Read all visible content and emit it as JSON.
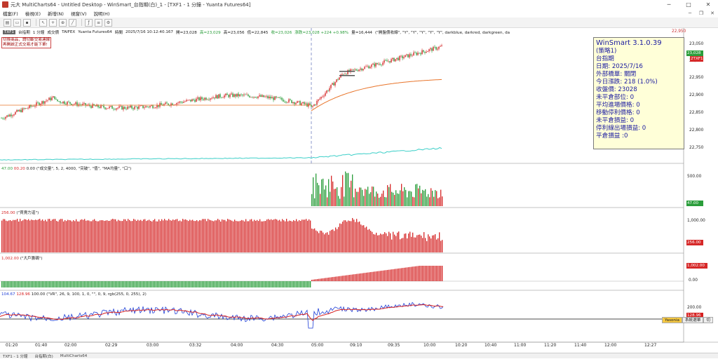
{
  "window": {
    "title": "元大 MultiCharts64 - Untitled Desktop - WinSmart_台指期(白)_1 - [TXF1 - 1 分鐘 - Yuanta Futures64]"
  },
  "menu": [
    "檔案(F)",
    "檢視(E)",
    "新增(N)",
    "視窗(V)",
    "說明(H)"
  ],
  "statusline": {
    "symbol": "TXF1",
    "description": "台指期",
    "interval": "1 分鐘",
    "settings": "成交價",
    "exchange": "TAIFEX",
    "feed": "Yuanta Futures64",
    "date_label": "時間",
    "datetime": "2025/7/16 10:12:40.167",
    "open": "開=23,028",
    "high": "高=23,029",
    "low": "低=22,849",
    "close": "高=23,056",
    "volume_low": "低=22,845",
    "close2": "收=23,026",
    "change": "漲跌=23,028 +224 +0.98%",
    "qty": "量=16,444",
    "study": "(\"開盤價收線\", \"Y\", \"Y\", \"Y\", \"Y\", \"Y\", darkblue, darkred, darkgreen, da"
  },
  "notice": {
    "line1": "切換商品，請切斷交易連線",
    "line2": "再開啟正式交易才能下單!"
  },
  "infobox": {
    "title": "WinSmart 3.1.0.39",
    "strategy": "(策略1)",
    "product": "台指期",
    "date": "日期: 2025/7/16",
    "order": "外部橋單: 關閉",
    "change": "今日漲跌: 218 (1.0%)",
    "close": "收盤價: 23028",
    "position": "未平倉部位: 0",
    "avg_price": "平均進場價格: 0",
    "trail_stop": "移動停利價格: 0",
    "unrealized": "未平倉損益: 0",
    "exit_pl": "停利線出場損益: 0",
    "closed_pl": "平倉損益 :0"
  },
  "panes": {
    "price": {
      "axis": [
        "23,050",
        "23,000",
        "22,950",
        "22,900",
        "22,850",
        "22,800",
        "22,750"
      ],
      "top_label": "22,950",
      "tag": "23,028",
      "tag2": "2TXF1"
    },
    "volume": {
      "legend_vals": [
        "47.00",
        "00.20",
        "0.00"
      ],
      "legend": "(\"成交量\", 5, 2, 4000, \"突破\", \"值\", \"MA均量\", \"口\")",
      "axis": [
        "500.00"
      ],
      "tag": "47.00"
    },
    "buy_sell": {
      "legend_val": "256.00",
      "legend": "(\"買賣力道\")",
      "axis": [
        "1,000.00"
      ],
      "tag": "256.00"
    },
    "big_player": {
      "legend_val": "1,002.00",
      "legend": "(\"大戶籌碼\")",
      "axis": [
        "0.00"
      ],
      "tag": "1,002.00"
    },
    "vr": {
      "legend_vals": [
        "104.67",
        "128.96",
        "100.00"
      ],
      "legend": "(\"VR\", 26, 9, 100, 1, 0, \"\", 0, 9, rgb(255, 0, 255), 2)",
      "axis": [
        "200.00"
      ],
      "tag": "128.96"
    }
  },
  "time_axis": [
    "01:20",
    "01:40",
    "02:00",
    "02:29",
    "03:00",
    "03:32",
    "04:00",
    "04:30",
    "05:00",
    "09:10",
    "09:35",
    "10:00",
    "10:20",
    "10:40",
    "11:00",
    "11:20",
    "11:40",
    "12:00",
    "12:27"
  ],
  "bottom_buttons": [
    "Yasonia",
    "系統選單",
    "切"
  ],
  "taskbar": [
    "TXF1 - 1 分鐘",
    "台指期(白)",
    "MultiCharts64"
  ],
  "colors": {
    "up": "#d62828",
    "down": "#2a9d3a",
    "ma_orange": "#e8742a",
    "teal": "#3ccfc8",
    "vr_blue": "#1f3fd6",
    "vr_red": "#d62020"
  }
}
